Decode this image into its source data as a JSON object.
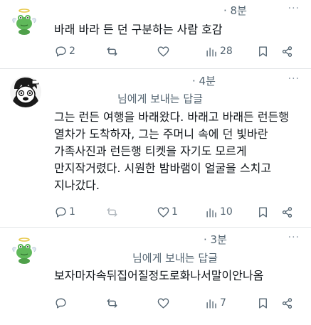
{
  "posts": [
    {
      "time": "· 8분",
      "reply_to": "",
      "text": "바래 바라 든 던 구분하는 사람 호감",
      "replies": "2",
      "reposts": "",
      "likes": "",
      "views": "28",
      "avatar": "frog-angel-avatar"
    },
    {
      "time": "· 4분",
      "reply_to": "님에게 보내는 답글",
      "text_lines": [
        "그는 런든 여행을 바래왔다. 바래고 바래든 런든행",
        "열차가 도착하자, 그는 주머니 속에 던 빛바란",
        "가족사진과 런든행 티켓을 자기도 모르게",
        "만지작거렸다. 시원한 밤바램이 얼굴을 스치고",
        "지나갔다."
      ],
      "replies": "1",
      "reposts": "",
      "likes": "1",
      "views": "10",
      "avatar": "cartoon-face-avatar"
    },
    {
      "time": "· 3분",
      "reply_to": "님에게 보내는 답글",
      "text": "보자마자속뒤집어질정도로화나서말이안나옴",
      "replies": "",
      "reposts": "",
      "likes": "",
      "views": "7",
      "avatar": "frog-angel-avatar"
    }
  ],
  "icons": {
    "reply": "reply-icon",
    "repost": "repost-icon",
    "like": "heart-icon",
    "views": "views-icon",
    "bookmark": "bookmark-icon",
    "share": "share-icon",
    "more": "more-icon"
  },
  "more_label": "···",
  "colors": {
    "text": "#0f1419",
    "muted": "#536471",
    "divider": "#e3e6e8",
    "frog": "#5fb85a"
  }
}
